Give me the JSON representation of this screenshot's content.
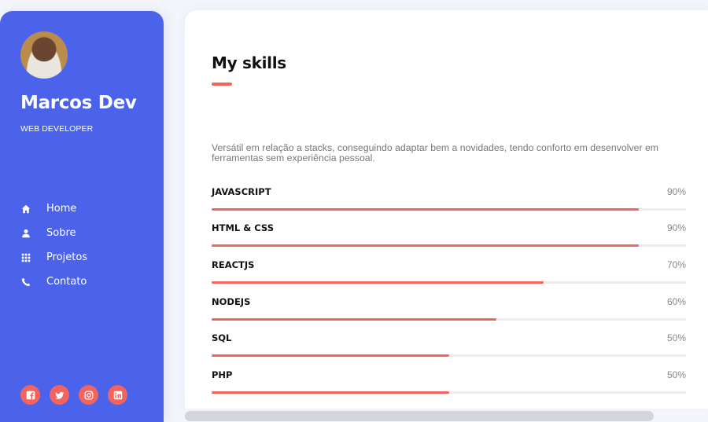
{
  "profile": {
    "name": "Marcos Dev",
    "role": "WEB DEVELOPER"
  },
  "nav": [
    {
      "label": "Home",
      "icon": "home-icon"
    },
    {
      "label": "Sobre",
      "icon": "user-icon"
    },
    {
      "label": "Projetos",
      "icon": "grid-icon"
    },
    {
      "label": "Contato",
      "icon": "phone-icon"
    }
  ],
  "socials": [
    "facebook-icon",
    "twitter-icon",
    "instagram-icon",
    "linkedin-icon"
  ],
  "section": {
    "title": "My skills",
    "description": "Versátil em relação a stacks, conseguindo adaptar bem a novidades, tendo conforto em desenvolver em ferramentas sem experiência pessoal."
  },
  "skills": [
    {
      "name": "JAVASCRIPT",
      "percent_label": "90%",
      "level": 0.9
    },
    {
      "name": "HTML & CSS",
      "percent_label": "90%",
      "level": 0.9
    },
    {
      "name": "REACTJS",
      "percent_label": "70%",
      "level": 0.7
    },
    {
      "name": "NODEJS",
      "percent_label": "60%",
      "level": 0.6
    },
    {
      "name": "SQL",
      "percent_label": "50%",
      "level": 0.5
    },
    {
      "name": "PHP",
      "percent_label": "50%",
      "level": 0.5
    }
  ],
  "colors": {
    "sidebar": "#4b63ea",
    "accent": "#f4645f",
    "track": "#ececef"
  }
}
